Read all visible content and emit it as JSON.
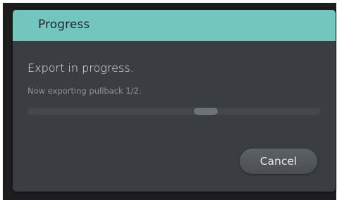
{
  "dialog": {
    "title": "Progress",
    "message": "Export in progress.",
    "status": "Now exporting pullback 1/2.",
    "cancel_label": "Cancel",
    "header_color": "#72c6bd",
    "background_color": "#3a3e43"
  },
  "progress": {
    "mode": "indeterminate"
  }
}
